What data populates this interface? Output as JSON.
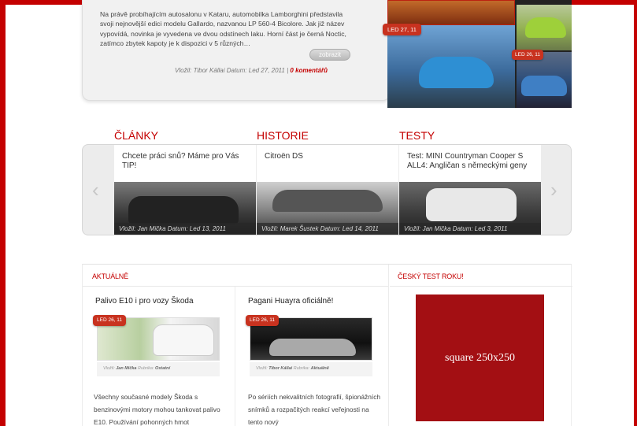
{
  "top_article": {
    "text": "Na právě probíhajícím autosalonu v Kataru, automobilka Lamborghini představila svoji nejnovější edici modelu Gallardo, nazvanou LP 560-4 Bicolore. Jak již název vypovídá, novinka je vyvedena ve dvou odstínech laku. Horní část je černá Noctic, zatímco zbytek kapoty je k dispozici v 5 různých…",
    "button": "zobrazit",
    "meta": "Vložil: Tibor Kállai Datum: Led 27, 2011 |",
    "comments": "0 komentářů"
  },
  "gallery": {
    "badge_main": "LED 27, 11",
    "badge_thumb": "LED 26, 11"
  },
  "categories": [
    {
      "label": "ČLÁNKY"
    },
    {
      "label": "HISTORIE"
    },
    {
      "label": "TESTY"
    }
  ],
  "slider": {
    "prev": "‹",
    "next": "›",
    "slides": [
      {
        "title": "Chcete práci snů? Máme pro Vás TIP!",
        "caption": "Vložil: Jan Mička Datum: Led 13, 2011"
      },
      {
        "title": "Citroën DS",
        "caption": "Vložil: Marek Šustek Datum: Led 14, 2011"
      },
      {
        "title": "Test: MINI Countryman Cooper S ALL4: Angličan s německými geny",
        "caption": "Vložil: Jan Mička Datum: Led 3, 2011"
      }
    ]
  },
  "aktualne": {
    "heading": "AKTUÁLNĚ",
    "articles": [
      {
        "title": "Palivo E10 i pro vozy Škoda",
        "badge": "LED 26, 11",
        "meta_author_label": "Vložil:",
        "meta_author": "Jan Mička",
        "meta_cat_label": "Rubrika:",
        "meta_cat": "Ostatní",
        "text": "Všechny současné modely Škoda s benzinovými motory mohou tankovat palivo E10. Používání pohonných hmot"
      },
      {
        "title": "Pagani Huayra oficiálně!",
        "badge": "LED 26, 11",
        "meta_author_label": "Vložil:",
        "meta_author": "Tibor Kállai",
        "meta_cat_label": "Rubrika:",
        "meta_cat": "Aktuálně",
        "text": "Po sériích nekvalitních fotografií, špionážních snímků a rozpačitých reakcí veřejnosti na tento nový"
      }
    ]
  },
  "cesky_test": {
    "heading": "ČESKÝ TEST ROKU!",
    "ad_label": "square 250x250"
  },
  "colors": {
    "accent": "#c40000",
    "ad_background": "#a30f13",
    "badge": "#c8321f"
  }
}
